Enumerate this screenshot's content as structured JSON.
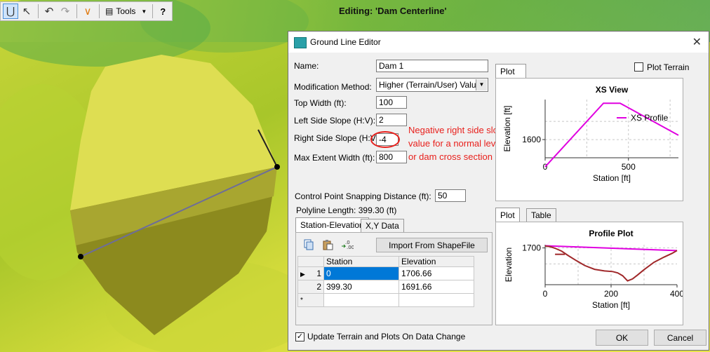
{
  "toolbar": {
    "tools_label": "Tools",
    "help_label": "?"
  },
  "editing_title": "Editing: 'Dam Centerline'",
  "colors": {
    "annotation": "#e8201c",
    "xs_profile": "#e000e0",
    "terrain_line": "#a0282a",
    "selection": "#0078d7"
  },
  "dialog": {
    "title": "Ground Line Editor",
    "close_label": "✕",
    "fields": {
      "name": {
        "label": "Name:",
        "value": "Dam 1"
      },
      "method": {
        "label": "Modification Method:",
        "value": "Higher (Terrain/User) Value"
      },
      "top_width": {
        "label": "Top Width (ft):",
        "value": "100"
      },
      "left_slope": {
        "label": "Left Side Slope (H:V):",
        "value": "2"
      },
      "right_slope": {
        "label": "Right Side Slope (H:V):",
        "value": "-4"
      },
      "max_extent": {
        "label": "Max Extent Width (ft):",
        "value": "800"
      },
      "snapping": {
        "label": "Control Point Snapping Distance (ft):",
        "value": "50"
      }
    },
    "annotation": "Negative right side slope value for a normal levee or dam cross section",
    "polyline_length": "Polyline Length: 399.30 (ft)",
    "data_tabs": [
      "Station-Elevation",
      "X,Y Data"
    ],
    "import_button": "Import From ShapeFile",
    "table": {
      "headers": [
        "Station",
        "Elevation"
      ],
      "rows": [
        {
          "num": "1",
          "station": "0",
          "elevation": "1706.66"
        },
        {
          "num": "2",
          "station": "399.30",
          "elevation": "1691.66"
        }
      ],
      "new_row_marker": "*",
      "current_row_marker": "▶"
    },
    "update_checkbox": "Update Terrain and Plots On Data Change",
    "ok_button": "OK",
    "cancel_button": "Cancel",
    "upper_plot_tabs": [
      "Plot"
    ],
    "plot_terrain_label": "Plot Terrain",
    "lower_plot_tabs": [
      "Plot",
      "Table"
    ]
  },
  "xs_chart": {
    "chart_data": {
      "type": "line",
      "title": "XS View",
      "xlabel": "Station [ft]",
      "ylabel": "Elevation [ft]",
      "x_ticks": [
        "0",
        "500"
      ],
      "y_ticks": [
        "1600"
      ],
      "xlim": [
        0,
        800
      ],
      "ylim": [
        1550,
        1710
      ],
      "series": [
        {
          "name": "XS Profile",
          "x": [
            0,
            350,
            450,
            800
          ],
          "y": [
            1525,
            1700,
            1700,
            1612
          ]
        }
      ],
      "legend": "top-right",
      "grid": true
    }
  },
  "profile_chart": {
    "chart_data": {
      "type": "line",
      "title": "Profile Plot",
      "xlabel": "Station [ft]",
      "ylabel": "Elevation",
      "x_ticks": [
        "0",
        "200",
        "400"
      ],
      "y_ticks": [
        "1700"
      ],
      "xlim": [
        0,
        400
      ],
      "ylim": [
        1585,
        1710
      ],
      "series": [
        {
          "x": [
            0,
            400
          ],
          "y": [
            1706.66,
            1691.66
          ]
        },
        {
          "x": [
            0,
            15,
            30,
            50,
            70,
            95,
            120,
            150,
            180,
            205,
            220,
            235,
            250,
            265,
            280,
            300,
            330,
            360,
            385,
            400
          ],
          "y": [
            1706,
            1704,
            1699,
            1690,
            1676,
            1660,
            1645,
            1633,
            1628,
            1626,
            1622,
            1613,
            1597,
            1603,
            1615,
            1632,
            1655,
            1671,
            1683,
            1692
          ]
        },
        {
          "x": [
            30,
            60
          ],
          "y": [
            1680,
            1680
          ]
        }
      ],
      "grid": true
    }
  }
}
